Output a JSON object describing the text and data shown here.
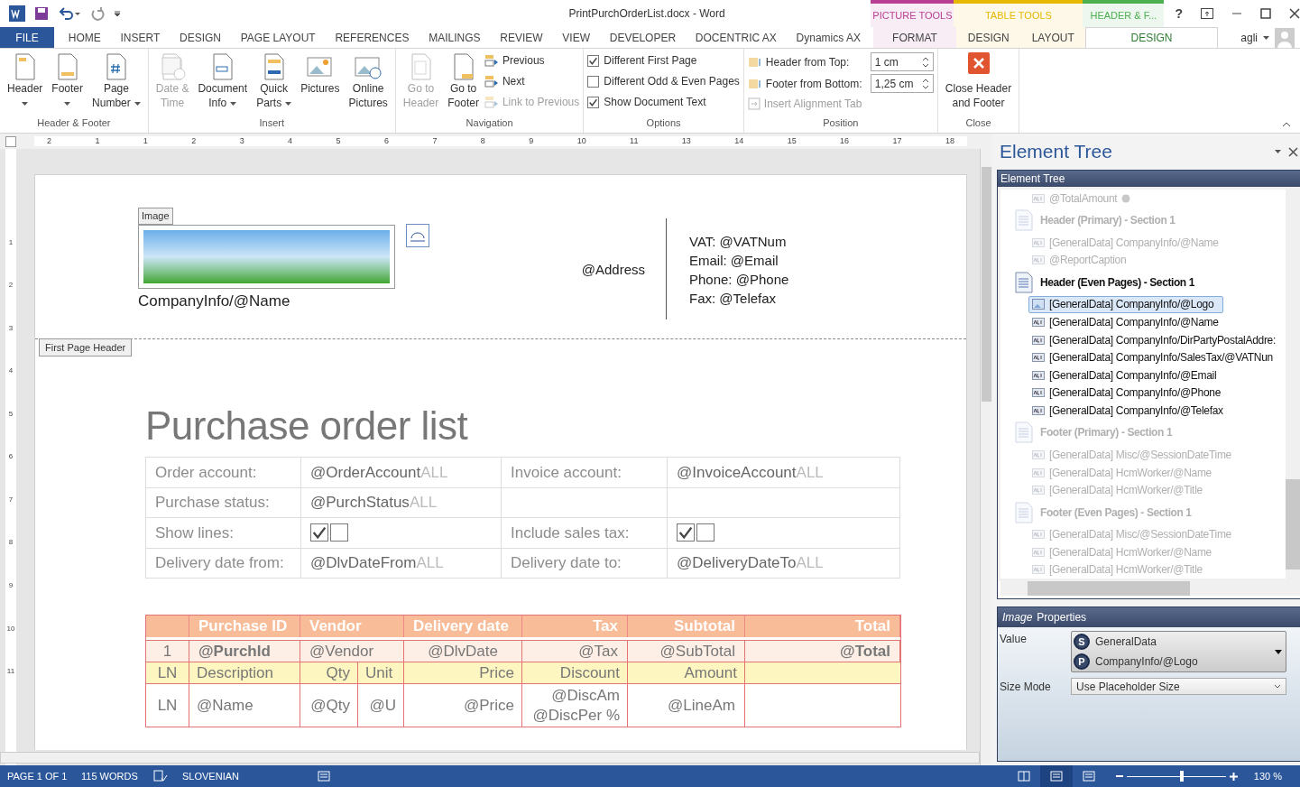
{
  "title_bar": {
    "title": "PrintPurchOrderList.docx - Word",
    "help": "?",
    "user": "agli"
  },
  "tabs": [
    {
      "label": "FILE",
      "kind": "file",
      "selected": false
    },
    {
      "label": "HOME",
      "kind": "main",
      "selected": false
    },
    {
      "label": "INSERT",
      "kind": "main",
      "selected": false
    },
    {
      "label": "DESIGN",
      "kind": "main",
      "selected": false
    },
    {
      "label": "PAGE LAYOUT",
      "kind": "main",
      "selected": false
    },
    {
      "label": "REFERENCES",
      "kind": "main",
      "selected": false
    },
    {
      "label": "MAILINGS",
      "kind": "main",
      "selected": false
    },
    {
      "label": "REVIEW",
      "kind": "main",
      "selected": false
    },
    {
      "label": "VIEW",
      "kind": "main",
      "selected": false
    },
    {
      "label": "DEVELOPER",
      "kind": "main",
      "selected": false
    },
    {
      "label": "DOCENTRIC AX",
      "kind": "main",
      "selected": false
    },
    {
      "label": "Dynamics AX",
      "kind": "main",
      "selected": false
    }
  ],
  "context_groups": [
    {
      "label": "PICTURE TOOLS",
      "color": "#b83f93",
      "tabs": [
        {
          "label": "FORMAT",
          "selected": false
        }
      ]
    },
    {
      "label": "TABLE TOOLS",
      "color": "#e6b800",
      "tabs": [
        {
          "label": "DESIGN",
          "selected": false
        },
        {
          "label": "LAYOUT",
          "selected": false
        }
      ]
    },
    {
      "label": "HEADER & F...",
      "color": "#4caf50",
      "tabs": [
        {
          "label": "DESIGN",
          "selected": true
        }
      ]
    }
  ],
  "ribbon": {
    "groups": [
      {
        "label": "Header & Footer",
        "items": [
          {
            "kind": "large",
            "lines": [
              "Header"
            ],
            "dropdown": true,
            "disabled": false
          },
          {
            "kind": "large",
            "lines": [
              "Footer"
            ],
            "dropdown": true,
            "disabled": false
          },
          {
            "kind": "large",
            "lines": [
              "Page",
              "Number"
            ],
            "dropdown": true,
            "disabled": false
          }
        ]
      },
      {
        "label": "Insert",
        "items": [
          {
            "kind": "large",
            "lines": [
              "Date &",
              "Time"
            ],
            "dropdown": false,
            "disabled": true
          },
          {
            "kind": "large",
            "lines": [
              "Document",
              "Info"
            ],
            "dropdown": true,
            "disabled": false
          },
          {
            "kind": "large",
            "lines": [
              "Quick",
              "Parts"
            ],
            "dropdown": true,
            "disabled": false
          },
          {
            "kind": "large",
            "lines": [
              "Pictures"
            ],
            "dropdown": false,
            "disabled": false
          },
          {
            "kind": "large",
            "lines": [
              "Online",
              "Pictures"
            ],
            "dropdown": false,
            "disabled": false
          }
        ]
      },
      {
        "label": "Navigation",
        "items": [
          {
            "kind": "large",
            "lines": [
              "Go to",
              "Header"
            ],
            "dropdown": false,
            "disabled": true
          },
          {
            "kind": "large",
            "lines": [
              "Go to",
              "Footer"
            ],
            "dropdown": false,
            "disabled": false
          },
          {
            "kind": "stack",
            "items": [
              {
                "label": "Previous",
                "disabled": false
              },
              {
                "label": "Next",
                "disabled": false
              },
              {
                "label": "Link to Previous",
                "disabled": true
              }
            ]
          }
        ]
      },
      {
        "label": "Options",
        "items": [
          {
            "kind": "checks",
            "items": [
              {
                "label": "Different First Page",
                "checked": true
              },
              {
                "label": "Different Odd & Even Pages",
                "checked": false
              },
              {
                "label": "Show Document Text",
                "checked": true
              }
            ]
          }
        ]
      },
      {
        "label": "Position",
        "items": [
          {
            "kind": "position",
            "spins": [
              {
                "label": "Header from Top:",
                "value": "1 cm"
              },
              {
                "label": "Footer from Bottom:",
                "value": "1,25 cm"
              }
            ],
            "extra": {
              "label": "Insert Alignment Tab",
              "disabled": true
            }
          }
        ]
      },
      {
        "label": "Close",
        "items": [
          {
            "kind": "close",
            "lines": [
              "Close Header",
              "and Footer"
            ]
          }
        ]
      }
    ]
  },
  "ruler": {
    "labels": [
      "2",
      "1",
      "1",
      "2",
      "3",
      "4",
      "5",
      "6",
      "7",
      "8",
      "9",
      "10",
      "11",
      "13",
      "14",
      "15",
      "16",
      "17",
      "18"
    ],
    "vertical": [
      "1",
      "2",
      "3",
      "4",
      "5",
      "6",
      "7",
      "8",
      "9",
      "10",
      "11"
    ]
  },
  "document": {
    "header": {
      "image_tag": "Image",
      "company_name": "CompanyInfo/@Name",
      "address": "@Address",
      "contacts": [
        "VAT: @VATNum",
        "Email: @Email",
        "Phone: @Phone",
        "Fax: @Telefax"
      ],
      "section_tag": "First Page Header"
    },
    "title": "Purchase order list",
    "params": [
      [
        {
          "kind": "label",
          "text": "Order account:"
        },
        {
          "kind": "value",
          "text": "@OrderAccount",
          "suffix": "ALL"
        },
        {
          "kind": "label",
          "text": "Invoice account:"
        },
        {
          "kind": "value",
          "text": "@InvoiceAccount",
          "suffix": "ALL"
        }
      ],
      [
        {
          "kind": "label",
          "text": "Purchase status:"
        },
        {
          "kind": "value",
          "text": "@PurchStatus",
          "suffix": "ALL"
        },
        {
          "kind": "empty"
        },
        {
          "kind": "empty"
        }
      ],
      [
        {
          "kind": "label",
          "text": "Show lines:"
        },
        {
          "kind": "checks",
          "checks": [
            true,
            false
          ]
        },
        {
          "kind": "label",
          "text": "Include sales tax:"
        },
        {
          "kind": "checks",
          "checks": [
            true,
            false
          ]
        }
      ],
      [
        {
          "kind": "label",
          "text": "Delivery date from:"
        },
        {
          "kind": "value",
          "text": "@DlvDateFrom",
          "suffix": "ALL"
        },
        {
          "kind": "label",
          "text": "Delivery date to:"
        },
        {
          "kind": "value",
          "text": "@DeliveryDateTo",
          "suffix": "ALL"
        }
      ]
    ],
    "orders": {
      "columns": [
        "Purchase ID",
        "Vendor",
        "Delivery date",
        "Tax",
        "Subtotal",
        "Total"
      ],
      "order_row": [
        "1",
        "@PurchId",
        "@Vendor",
        "@DlvDate",
        "@Tax",
        "@SubTotal",
        "@Total"
      ],
      "line_header": [
        "LN",
        "Description",
        "Qty",
        "Unit",
        "Price",
        "Discount",
        "Amount"
      ],
      "line_row": [
        "LN",
        "@Name",
        "@Qty",
        "@U",
        "@Price",
        "@DiscAm",
        "@DiscPer %",
        "@LineAm"
      ]
    }
  },
  "pane": {
    "title": "Element Tree",
    "tree_title": "Element Tree",
    "tree": [
      {
        "kind": "field",
        "label": "@TotalAmount",
        "disabled": true,
        "selected": false,
        "flagged": true
      },
      {
        "kind": "section",
        "label": "Header (Primary) - Section 1",
        "disabled": true,
        "children": [
          {
            "kind": "field",
            "label": "[GeneralData] CompanyInfo/@Name",
            "disabled": true,
            "selected": false,
            "flagged": false
          },
          {
            "kind": "field",
            "label": "@ReportCaption",
            "disabled": true,
            "selected": false,
            "flagged": false
          }
        ]
      },
      {
        "kind": "section",
        "label": "Header (Even Pages) - Section 1",
        "disabled": false,
        "children": [
          {
            "kind": "image",
            "label": "[GeneralData] CompanyInfo/@Logo",
            "disabled": false,
            "selected": true,
            "flagged": false
          },
          {
            "kind": "field",
            "label": "[GeneralData] CompanyInfo/@Name",
            "disabled": false,
            "selected": false,
            "flagged": false
          },
          {
            "kind": "field",
            "label": "[GeneralData] CompanyInfo/DirPartyPostalAddre:",
            "disabled": false,
            "selected": false,
            "flagged": false
          },
          {
            "kind": "field",
            "label": "[GeneralData] CompanyInfo/SalesTax/@VATNun",
            "disabled": false,
            "selected": false,
            "flagged": false
          },
          {
            "kind": "field",
            "label": "[GeneralData] CompanyInfo/@Email",
            "disabled": false,
            "selected": false,
            "flagged": false
          },
          {
            "kind": "field",
            "label": "[GeneralData] CompanyInfo/@Phone",
            "disabled": false,
            "selected": false,
            "flagged": false
          },
          {
            "kind": "field",
            "label": "[GeneralData] CompanyInfo/@Telefax",
            "disabled": false,
            "selected": false,
            "flagged": false
          }
        ]
      },
      {
        "kind": "section",
        "label": "Footer (Primary) - Section 1",
        "disabled": true,
        "children": [
          {
            "kind": "field",
            "label": "[GeneralData] Misc/@SessionDateTime",
            "disabled": true,
            "selected": false,
            "flagged": false
          },
          {
            "kind": "field",
            "label": "[GeneralData] HcmWorker/@Name",
            "disabled": true,
            "selected": false,
            "flagged": false
          },
          {
            "kind": "field",
            "label": "[GeneralData] HcmWorker/@Title",
            "disabled": true,
            "selected": false,
            "flagged": false
          }
        ]
      },
      {
        "kind": "section",
        "label": "Footer (Even Pages) - Section 1",
        "disabled": true,
        "children": [
          {
            "kind": "field",
            "label": "[GeneralData] Misc/@SessionDateTime",
            "disabled": true,
            "selected": false,
            "flagged": false
          },
          {
            "kind": "field",
            "label": "[GeneralData] HcmWorker/@Name",
            "disabled": true,
            "selected": false,
            "flagged": false
          },
          {
            "kind": "field",
            "label": "[GeneralData] HcmWorker/@Title",
            "disabled": true,
            "selected": false,
            "flagged": false
          }
        ]
      }
    ],
    "properties": {
      "title_em": "Image",
      "title": "Properties",
      "value_label": "Value",
      "value": [
        {
          "letter": "S",
          "text": "GeneralData"
        },
        {
          "letter": "P",
          "text": "CompanyInfo/@Logo"
        }
      ],
      "size_label": "Size Mode",
      "size_mode": "Use Placeholder Size"
    }
  },
  "status_bar": {
    "page": "PAGE 1 OF 1",
    "words": "115 WORDS",
    "language": "SLOVENIAN",
    "views": [
      {
        "selected": false
      },
      {
        "selected": true
      },
      {
        "selected": false
      }
    ],
    "zoom": {
      "level": 0.56,
      "reading": "130 %"
    }
  }
}
